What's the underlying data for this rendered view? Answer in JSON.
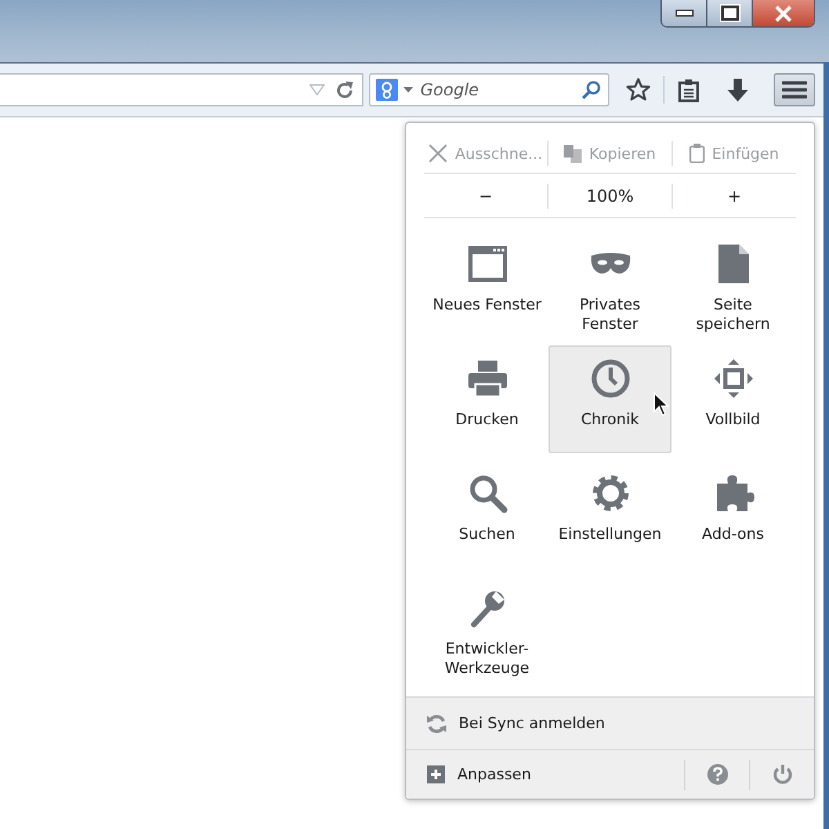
{
  "search": {
    "placeholder": "Google"
  },
  "edit_row": [
    {
      "label": "Ausschne...",
      "disabled": true
    },
    {
      "label": "Kopieren",
      "disabled": true
    },
    {
      "label": "Einfügen",
      "disabled": true
    }
  ],
  "zoom_row": {
    "minus": "−",
    "level": "100%",
    "plus": "+"
  },
  "items": [
    {
      "label": "Neues Fenster",
      "selected": false
    },
    {
      "label": "Privates Fenster",
      "selected": false
    },
    {
      "label": "Seite speichern",
      "selected": false
    },
    {
      "label": "Drucken",
      "selected": false
    },
    {
      "label": "Chronik",
      "selected": true
    },
    {
      "label": "Vollbild",
      "selected": false
    },
    {
      "label": "Suchen",
      "selected": false
    },
    {
      "label": "Einstellungen",
      "selected": false
    },
    {
      "label": "Add-ons",
      "selected": false
    },
    {
      "label": "Entwickler-Werkzeuge",
      "selected": false
    }
  ],
  "sync": {
    "label": "Bei Sync anmelden"
  },
  "footer": {
    "customize": "Anpassen"
  }
}
